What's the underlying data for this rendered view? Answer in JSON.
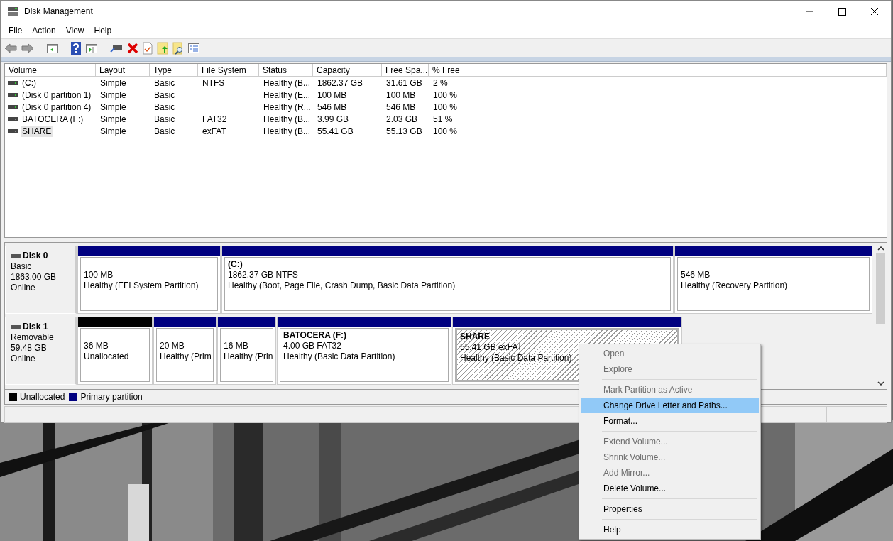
{
  "window": {
    "title": "Disk Management"
  },
  "menu_bar": [
    "File",
    "Action",
    "View",
    "Help"
  ],
  "volume_table": {
    "columns": [
      "Volume",
      "Layout",
      "Type",
      "File System",
      "Status",
      "Capacity",
      "Free Spa...",
      "% Free"
    ],
    "rows": [
      {
        "selected": false,
        "cells": [
          "(C:)",
          "Simple",
          "Basic",
          "NTFS",
          "Healthy (B...",
          "1862.37 GB",
          "31.61 GB",
          "2 %"
        ]
      },
      {
        "selected": false,
        "cells": [
          "(Disk 0 partition 1)",
          "Simple",
          "Basic",
          "",
          "Healthy (E...",
          "100 MB",
          "100 MB",
          "100 %"
        ]
      },
      {
        "selected": false,
        "cells": [
          "(Disk 0 partition 4)",
          "Simple",
          "Basic",
          "",
          "Healthy (R...",
          "546 MB",
          "546 MB",
          "100 %"
        ]
      },
      {
        "selected": false,
        "cells": [
          "BATOCERA (F:)",
          "Simple",
          "Basic",
          "FAT32",
          "Healthy (B...",
          "3.99 GB",
          "2.03 GB",
          "51 %"
        ]
      },
      {
        "selected": true,
        "cells": [
          "SHARE",
          "Simple",
          "Basic",
          "exFAT",
          "Healthy (B...",
          "55.41 GB",
          "55.13 GB",
          "100 %"
        ]
      }
    ]
  },
  "disks": [
    {
      "name": "Disk 0",
      "type": "Basic",
      "size": "1863.00 GB",
      "state": "Online",
      "partitions": [
        {
          "kind": "primary",
          "selected": false,
          "lines": [
            "100 MB",
            "Healthy (EFI System Partition)"
          ]
        },
        {
          "kind": "primary",
          "selected": false,
          "title": "(C:)",
          "lines": [
            "1862.37 GB NTFS",
            "Healthy (Boot, Page File, Crash Dump, Basic Data Partition)"
          ]
        },
        {
          "kind": "primary",
          "selected": false,
          "lines": [
            "546 MB",
            "Healthy (Recovery Partition)"
          ]
        }
      ]
    },
    {
      "name": "Disk 1",
      "type": "Removable",
      "size": "59.48 GB",
      "state": "Online",
      "partitions": [
        {
          "kind": "unallocated",
          "selected": false,
          "lines": [
            "36 MB",
            "Unallocated"
          ]
        },
        {
          "kind": "primary",
          "selected": false,
          "lines": [
            "20 MB",
            "Healthy (Prim"
          ]
        },
        {
          "kind": "primary",
          "selected": false,
          "lines": [
            "16 MB",
            "Healthy (Prin"
          ]
        },
        {
          "kind": "primary",
          "selected": false,
          "title": "BATOCERA  (F:)",
          "lines": [
            "4.00 GB FAT32",
            "Healthy (Basic Data Partition)"
          ]
        },
        {
          "kind": "primary",
          "selected": true,
          "title": "SHARE",
          "lines": [
            "55.41 GB exFAT",
            "Healthy (Basic Data Partition)"
          ]
        }
      ]
    }
  ],
  "legend": [
    {
      "kind": "unallocated",
      "label": "Unallocated"
    },
    {
      "kind": "primary",
      "label": "Primary partition"
    }
  ],
  "context_menu": [
    [
      {
        "label": "Open",
        "disabled": true,
        "selected": false
      },
      {
        "label": "Explore",
        "disabled": true,
        "selected": false
      }
    ],
    [
      {
        "label": "Mark Partition as Active",
        "disabled": true,
        "selected": false
      },
      {
        "label": "Change Drive Letter and Paths...",
        "disabled": false,
        "selected": true
      },
      {
        "label": "Format...",
        "disabled": false,
        "selected": false
      }
    ],
    [
      {
        "label": "Extend Volume...",
        "disabled": true,
        "selected": false
      },
      {
        "label": "Shrink Volume...",
        "disabled": true,
        "selected": false
      },
      {
        "label": "Add Mirror...",
        "disabled": true,
        "selected": false
      },
      {
        "label": "Delete Volume...",
        "disabled": false,
        "selected": false
      }
    ],
    [
      {
        "label": "Properties",
        "disabled": false,
        "selected": false
      }
    ],
    [
      {
        "label": "Help",
        "disabled": false,
        "selected": false
      }
    ]
  ]
}
